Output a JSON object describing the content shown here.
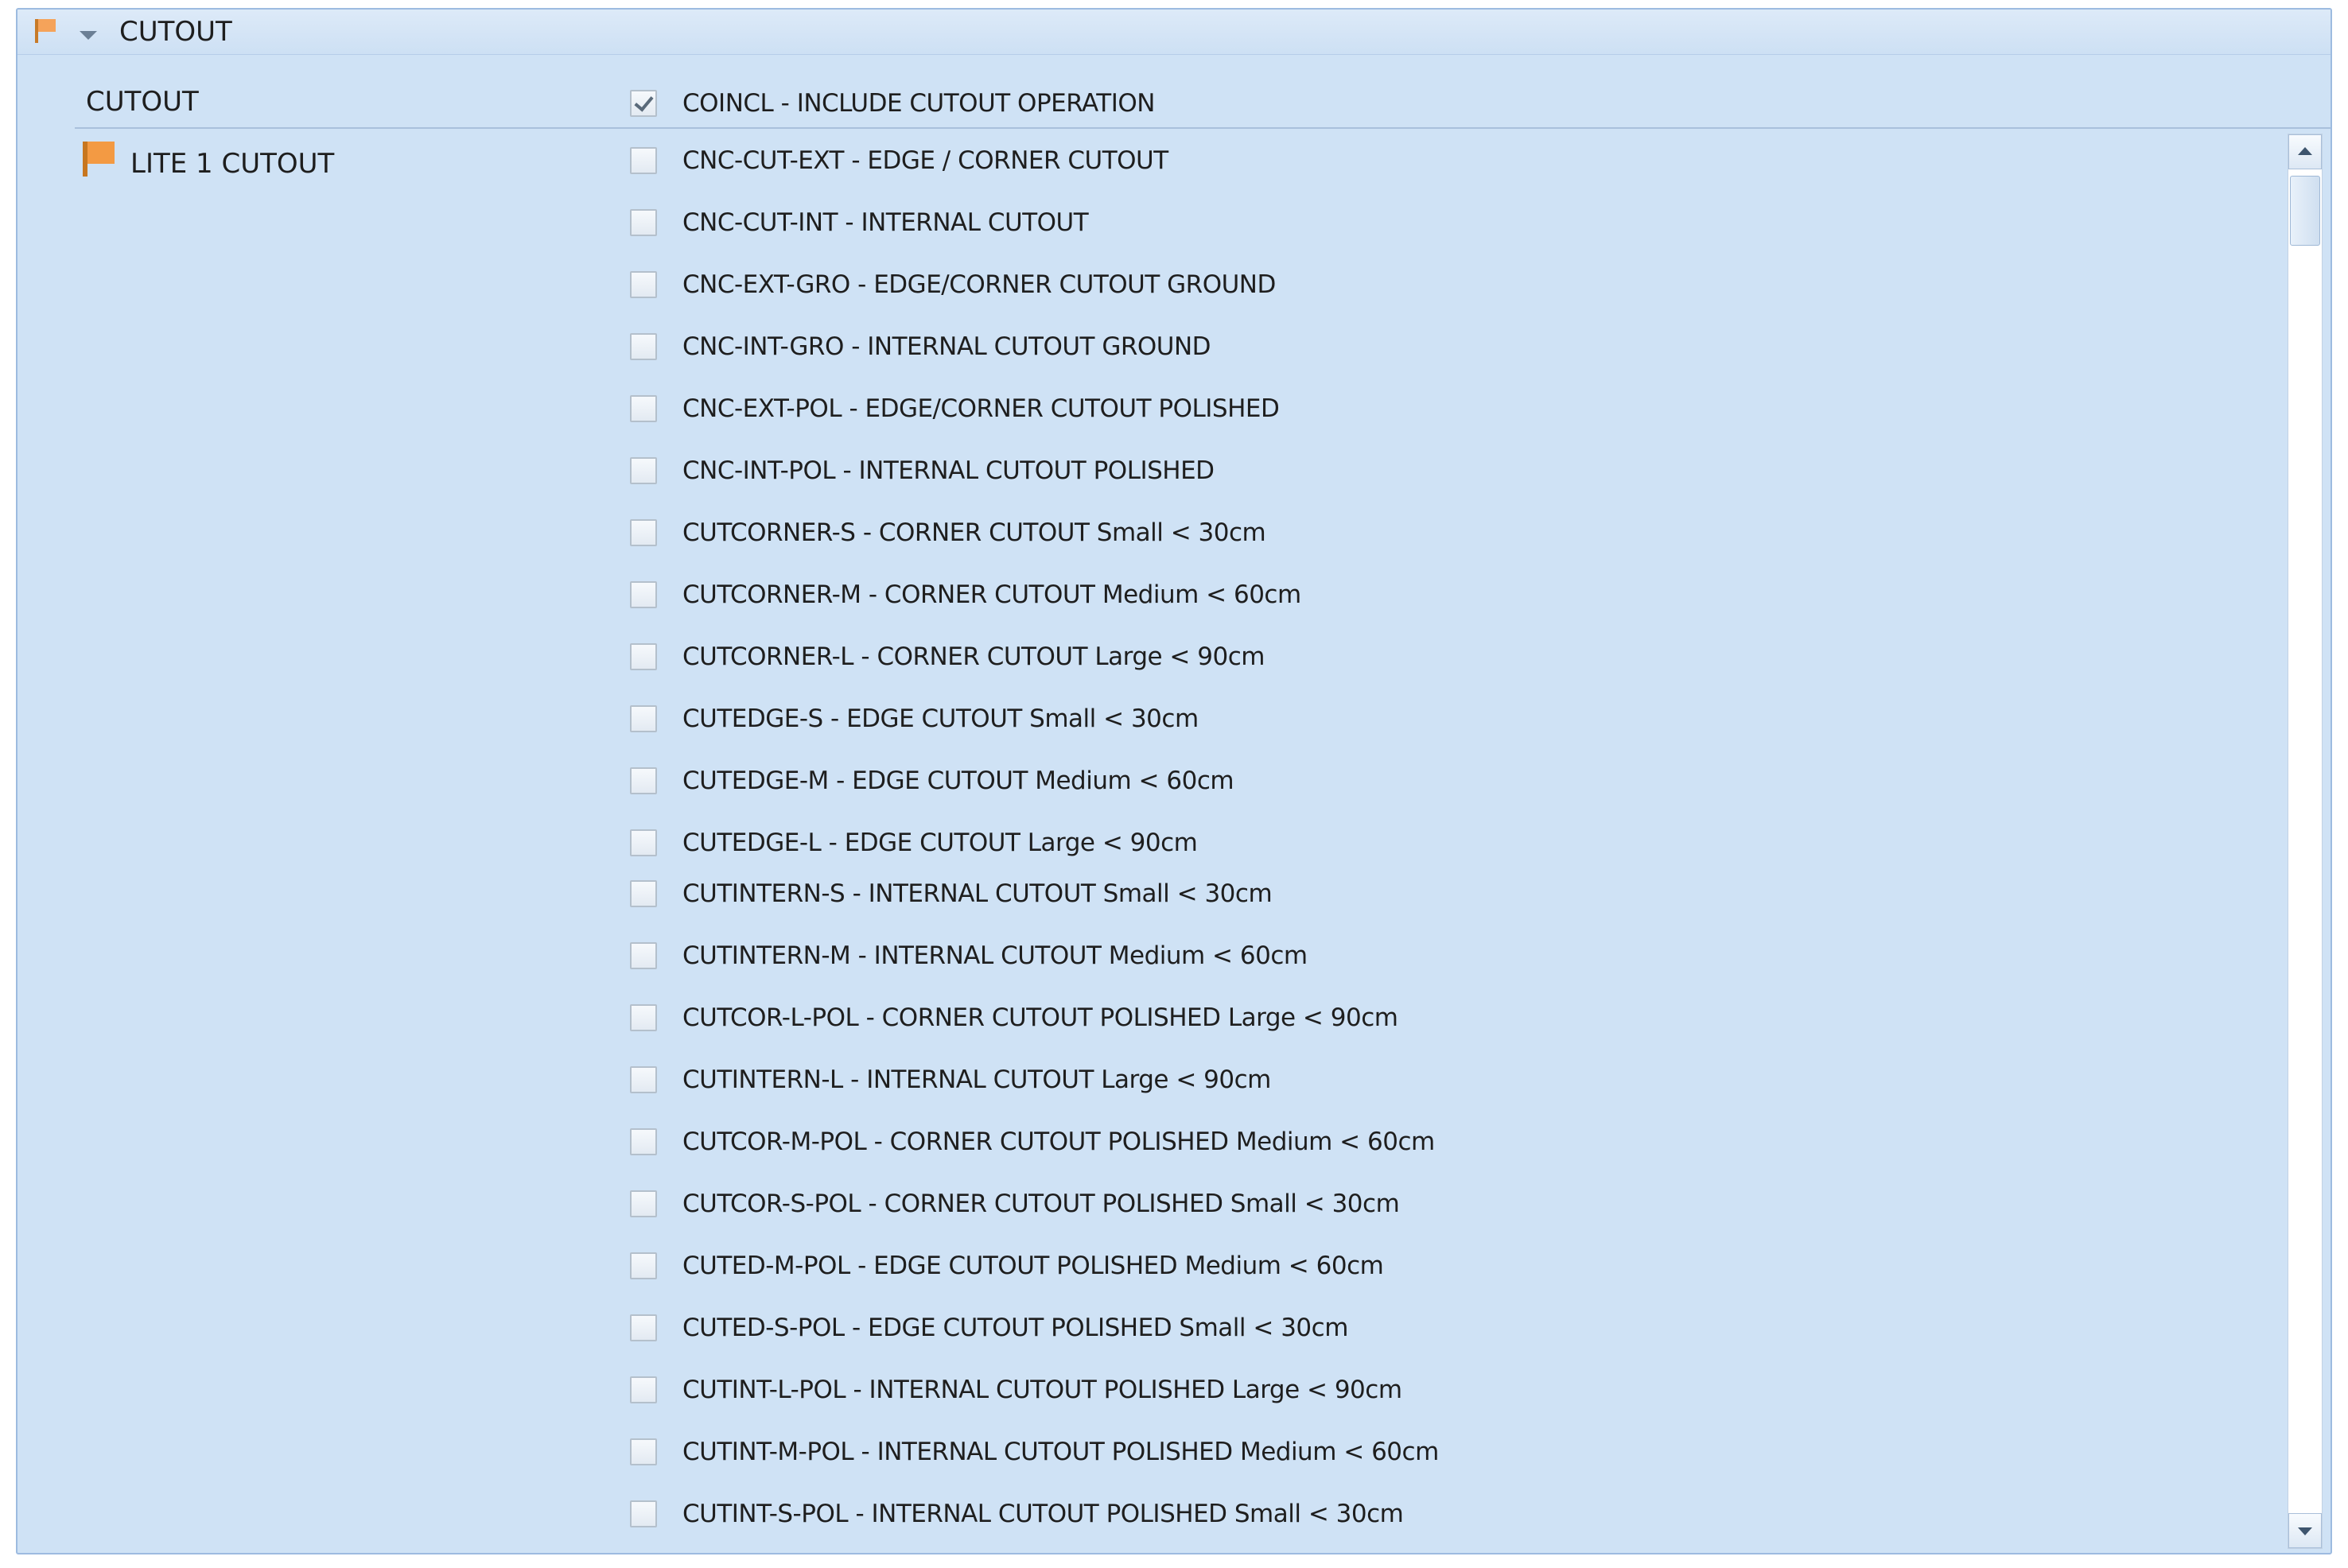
{
  "group": {
    "title": "CUTOUT"
  },
  "cutout_field": {
    "label": "CUTOUT",
    "option": {
      "label": "COINCL - INCLUDE CUTOUT OPERATION",
      "checked": true
    }
  },
  "lite_section": {
    "label": "LITE 1 CUTOUT",
    "options": [
      {
        "label": "CNC-CUT-EXT - EDGE / CORNER CUTOUT",
        "checked": false
      },
      {
        "label": "CNC-CUT-INT - INTERNAL CUTOUT",
        "checked": false
      },
      {
        "label": "CNC-EXT-GRO - EDGE/CORNER CUTOUT GROUND",
        "checked": false
      },
      {
        "label": "CNC-INT-GRO - INTERNAL CUTOUT GROUND",
        "checked": false
      },
      {
        "label": "CNC-EXT-POL - EDGE/CORNER CUTOUT POLISHED",
        "checked": false
      },
      {
        "label": "CNC-INT-POL - INTERNAL CUTOUT POLISHED",
        "checked": false
      },
      {
        "label": "CUTCORNER-S - CORNER CUTOUT Small < 30cm",
        "checked": false
      },
      {
        "label": "CUTCORNER-M - CORNER CUTOUT Medium < 60cm",
        "checked": false
      },
      {
        "label": "CUTCORNER-L - CORNER CUTOUT Large < 90cm",
        "checked": false
      },
      {
        "label": "CUTEDGE-S - EDGE CUTOUT Small < 30cm",
        "checked": false
      },
      {
        "label": "CUTEDGE-M - EDGE CUTOUT Medium < 60cm",
        "checked": false
      },
      {
        "label": "CUTEDGE-L - EDGE CUTOUT Large < 90cm",
        "checked": false
      },
      {
        "label": "CUTINTERN-S - INTERNAL CUTOUT Small < 30cm",
        "checked": false
      },
      {
        "label": "CUTINTERN-M - INTERNAL CUTOUT Medium < 60cm",
        "checked": false
      },
      {
        "label": "CUTCOR-L-POL - CORNER CUTOUT POLISHED Large < 90cm",
        "checked": false
      },
      {
        "label": "CUTINTERN-L - INTERNAL CUTOUT Large < 90cm",
        "checked": false
      },
      {
        "label": "CUTCOR-M-POL - CORNER CUTOUT POLISHED Medium < 60cm",
        "checked": false
      },
      {
        "label": "CUTCOR-S-POL - CORNER CUTOUT POLISHED Small < 30cm",
        "checked": false
      },
      {
        "label": "CUTED-M-POL - EDGE CUTOUT POLISHED Medium < 60cm",
        "checked": false
      },
      {
        "label": "CUTED-S-POL - EDGE CUTOUT POLISHED Small < 30cm",
        "checked": false
      },
      {
        "label": "CUTINT-L-POL - INTERNAL CUTOUT POLISHED Large < 90cm",
        "checked": false
      },
      {
        "label": "CUTINT-M-POL - INTERNAL CUTOUT POLISHED Medium < 60cm",
        "checked": false
      },
      {
        "label": "CUTINT-S-POL - INTERNAL CUTOUT POLISHED Small < 30cm",
        "checked": false
      }
    ]
  },
  "icons": {
    "group_flag": "flag-icon",
    "collapse": "chevron-down-icon",
    "section_flag": "flag-icon",
    "scroll_up": "arrow-up-icon",
    "scroll_down": "arrow-down-icon"
  },
  "colors": {
    "panel_bg": "#cfe2f5",
    "flag_orange": "#f39a43",
    "border": "#9dbbe0"
  }
}
